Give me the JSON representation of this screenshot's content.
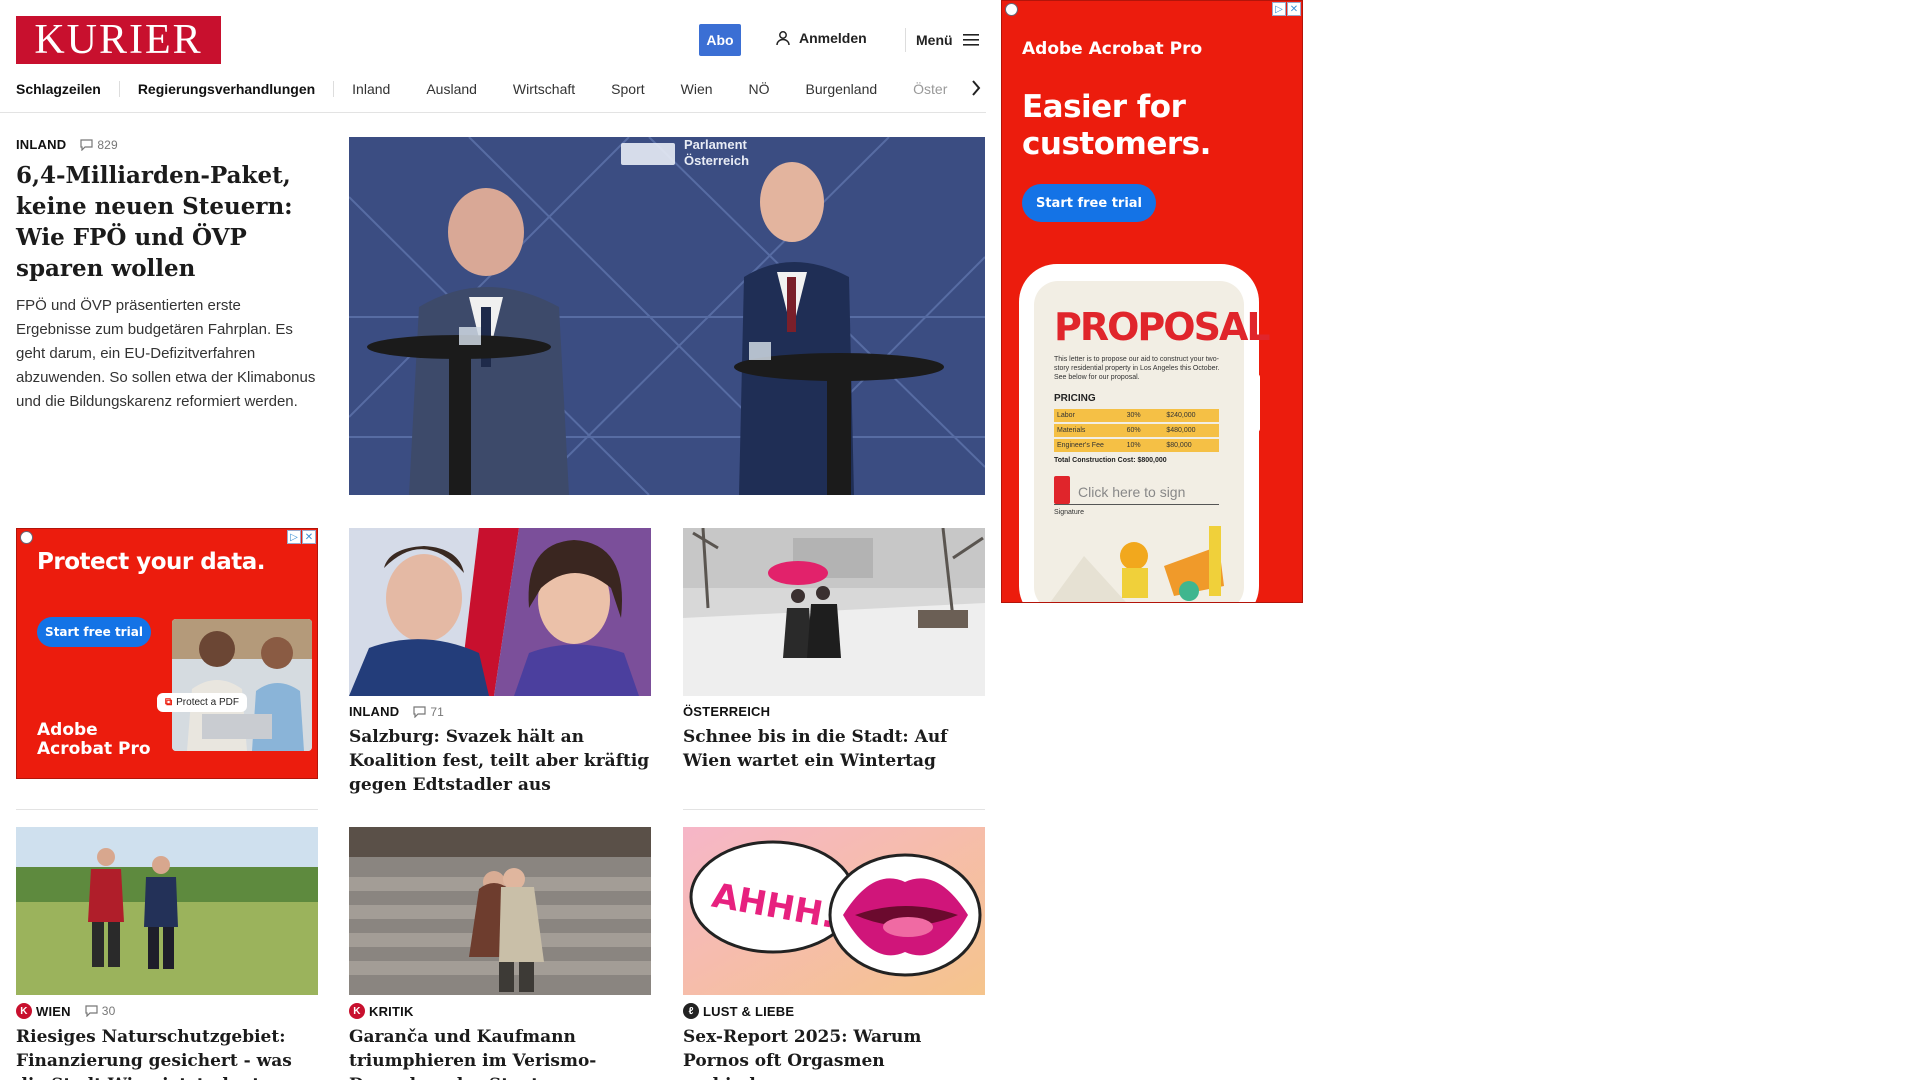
{
  "header": {
    "logo": "KURIER",
    "abo": "Abo",
    "login": "Anmelden",
    "menu": "Menü"
  },
  "nav": {
    "items": [
      "Schlagzeilen",
      "Regierungsverhandlungen",
      "Inland",
      "Ausland",
      "Wirtschaft",
      "Sport",
      "Wien",
      "NÖ",
      "Burgenland",
      "Öster"
    ]
  },
  "lead": {
    "kicker": "INLAND",
    "comments": "829",
    "headline": "6,4-Milliarden-Paket, keine neuen Steuern: Wie FPÖ und ÖVP sparen wollen",
    "teaser": "FPÖ und ÖVP präsentierten erste Ergebnisse zum budgetären Fahrplan. Es geht darum, ein EU-Defizitverfahren abzuwenden. So sollen etwa der Klimabonus und die Bildungskarenz reformiert werden.",
    "image_text": "Parlament Österreich"
  },
  "cards": [
    {
      "kicker": "INLAND",
      "comments": "71",
      "headline": "Salzburg: Svazek hält an Koalition fest, teilt aber kräftig gegen Edt­stadler aus"
    },
    {
      "kicker": "ÖSTERREICH",
      "comments": "",
      "headline": "Schnee bis in die Stadt: Auf Wien wartet ein Wintertag"
    },
    {
      "kicker": "WIEN",
      "comments": "30",
      "headline": "Riesiges Naturschutzgebiet: Finan­zierung gesichert - was die Stadt Wien jetzt plant"
    },
    {
      "kicker": "KRITIK",
      "comments": "",
      "headline": "Garanča und Kaufmann triumphie­ren im Verismo-Doppel an der Staatsoper"
    },
    {
      "kicker": "LUST & LIEBE",
      "comments": "",
      "headline": "Sex-Report 2025: Warum Pornos oft Orgasmen verhindern"
    }
  ],
  "ad_small": {
    "title": "Protect your data.",
    "cta": "Start free trial",
    "chip": "Protect a PDF",
    "brand_line1": "Adobe",
    "brand_line2": "Acrobat Pro"
  },
  "ad_large": {
    "brand": "Adobe Acrobat Pro",
    "title_line1": "Easier for",
    "title_line2": "customers.",
    "cta": "Start free trial",
    "doc_title": "PROPOSAL",
    "doc_body": "This letter is to propose our aid to construct your two-story residential property in Los Angeles this October. See below for our proposal.",
    "pricing_label": "PRICING",
    "rows": [
      {
        "label": "Labor",
        "pct": "30%",
        "amount": "$240,000"
      },
      {
        "label": "Materials",
        "pct": "60%",
        "amount": "$480,000"
      },
      {
        "label": "Engineer's Fee",
        "pct": "10%",
        "amount": "$80,000"
      }
    ],
    "total": "Total Construction Cost: $800,000",
    "sign": "Click here to sign",
    "signature": "Signature"
  },
  "colors": {
    "brand_red": "#c8102e",
    "abo_blue": "#3b6fd4",
    "ad_red": "#ec1c0d",
    "ad_blue": "#1473e6"
  }
}
